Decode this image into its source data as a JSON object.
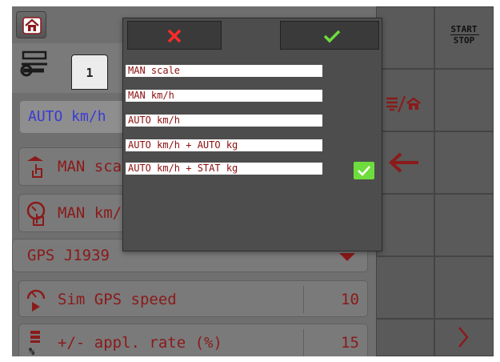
{
  "header": {
    "home_icon": "home-icon",
    "tab_number": "1",
    "settings_icon": "wrench-settings-icon"
  },
  "speed_source_selected": "AUTO km/h",
  "rows": [
    {
      "label": "MAN scale",
      "icon": "hand-scale-icon"
    },
    {
      "label": "MAN km/h",
      "icon": "hand-speed-icon"
    },
    {
      "label": "GPS J1939",
      "icon": ""
    }
  ],
  "sim_gps": {
    "label": "Sim GPS speed",
    "value": "10",
    "icon": "speedometer-play-icon"
  },
  "appl_rate": {
    "label": "+/- appl. rate (%)",
    "value": "15",
    "icon": "rate-percent-icon"
  },
  "softkeys": {
    "start_stop": [
      "START",
      "STOP"
    ],
    "switch_icon": "scale-home-switch-icon",
    "back_icon": "back-arrow-icon",
    "next_icon": "chevron-right-icon"
  },
  "dialog": {
    "cancel_icon": "cancel-x-icon",
    "confirm_icon": "confirm-check-icon",
    "options": [
      "MAN scale",
      "MAN km/h",
      "AUTO km/h",
      "AUTO km/h + AUTO kg",
      "AUTO km/h + STAT kg"
    ],
    "selected_index": 4
  },
  "colors": {
    "accent_red": "#8b1a1a",
    "cancel_red": "#ff2b2b",
    "confirm_green": "#6edc3c",
    "selection_blue": "#3a3ad6"
  }
}
